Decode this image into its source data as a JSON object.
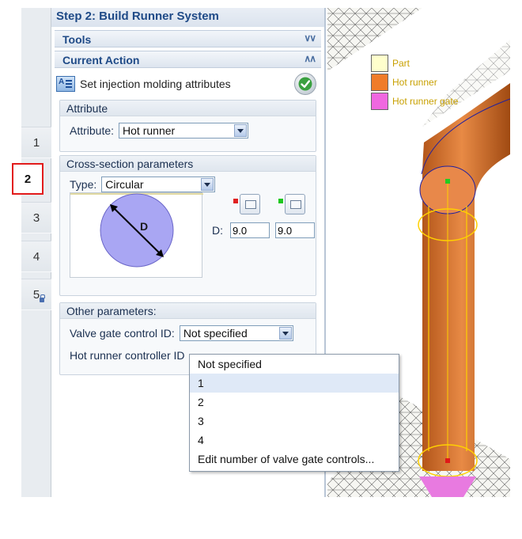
{
  "panel": {
    "title": "Step 2: Build Runner System",
    "tools_header": "Tools",
    "current_action_header": "Current Action",
    "action_label": "Set injection molding attributes"
  },
  "steps": [
    {
      "label": "1",
      "locked": false
    },
    {
      "label": "2",
      "locked": false,
      "active": true
    },
    {
      "label": "3",
      "locked": false
    },
    {
      "label": "4",
      "locked": false
    },
    {
      "label": "5",
      "locked": true
    }
  ],
  "attribute_group": {
    "header": "Attribute",
    "field_label": "Attribute:",
    "value": "Hot runner"
  },
  "cross_section": {
    "header": "Cross-section parameters",
    "type_label": "Type:",
    "type_value": "Circular",
    "diagram_label": "D",
    "d_label": "D:",
    "d_start": "9.0",
    "d_end": "9.0",
    "start_color": "#e02020",
    "end_color": "#1ec81e"
  },
  "other_params": {
    "header": "Other parameters:",
    "valve_label": "Valve gate control ID:",
    "valve_value": "Not specified",
    "controller_label": "Hot runner controller ID"
  },
  "valve_dropdown_options": [
    "Not specified",
    "1",
    "2",
    "3",
    "4",
    "Edit number of valve gate controls..."
  ],
  "legend": [
    {
      "label": "Part",
      "color": "#ffffcc"
    },
    {
      "label": "Hot runner",
      "color": "#f07c2a"
    },
    {
      "label": "Hot runner gate",
      "color": "#f068e0"
    }
  ]
}
